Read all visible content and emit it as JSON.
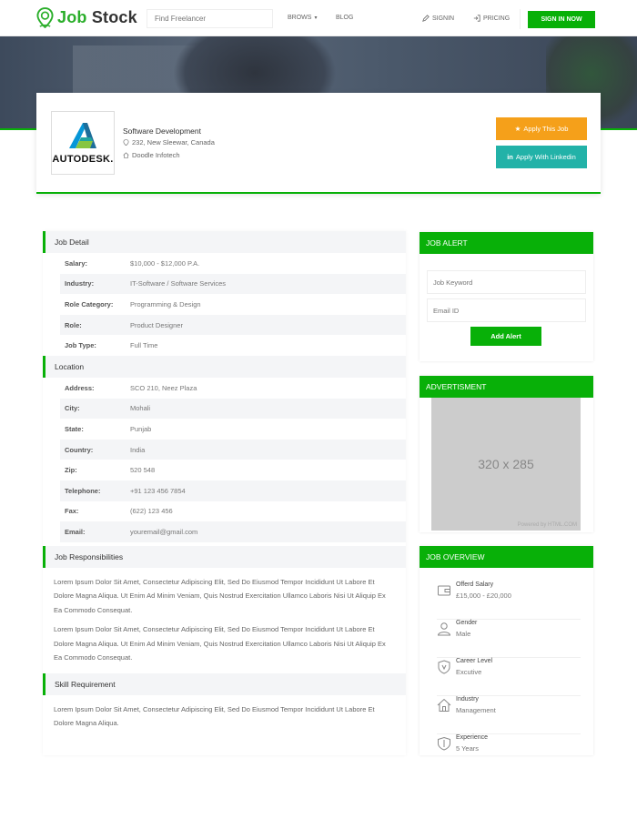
{
  "nav": {
    "logo_prefix": "Job",
    "logo_suffix": "Stock",
    "search_placeholder": "Find Freelancer",
    "brows_label": "BROWS",
    "blog_label": "BLOG",
    "signin_label": "SIGNIN",
    "pricing_label": "PRICING",
    "signup_label": "SIGN IN NOW"
  },
  "company": {
    "brand": "AUTODESK.",
    "title": "Software Development",
    "address": "232, New Sleewar, Canada",
    "employer": "Doodle Infotech",
    "apply_label": "Apply This Job",
    "linkedin_label": "Apply With Linkedin"
  },
  "job_detail": {
    "heading": "Job Detail",
    "rows": [
      {
        "k": "Salary:",
        "v": "$10,000 - $12,000 P.A."
      },
      {
        "k": "Industry:",
        "v": "IT-Software / Software Services"
      },
      {
        "k": "Role Category:",
        "v": "Programming & Design"
      },
      {
        "k": "Role:",
        "v": "Product Designer"
      },
      {
        "k": "Job Type:",
        "v": "Full Time"
      }
    ]
  },
  "location": {
    "heading": "Location",
    "rows": [
      {
        "k": "Address:",
        "v": "SCO 210, Neez Plaza"
      },
      {
        "k": "City:",
        "v": "Mohali"
      },
      {
        "k": "State:",
        "v": "Punjab"
      },
      {
        "k": "Country:",
        "v": "India"
      },
      {
        "k": "Zip:",
        "v": "520 548"
      },
      {
        "k": "Telephone:",
        "v": "+91 123 456 7854"
      },
      {
        "k": "Fax:",
        "v": "(622) 123 456"
      },
      {
        "k": "Email:",
        "v": "youremail@gmail.com"
      }
    ]
  },
  "responsibilities": {
    "heading": "Job Responsibilities",
    "p1": "Lorem Ipsum Dolor Sit Amet, Consectetur Adipiscing Elit, Sed Do Eiusmod Tempor Incididunt Ut Labore Et Dolore Magna Aliqua. Ut Enim Ad Minim Veniam, Quis Nostrud Exercitation Ullamco Laboris Nisi Ut Aliquip Ex Ea Commodo Consequat.",
    "p2": "Lorem Ipsum Dolor Sit Amet, Consectetur Adipiscing Elit, Sed Do Eiusmod Tempor Incididunt Ut Labore Et Dolore Magna Aliqua. Ut Enim Ad Minim Veniam, Quis Nostrud Exercitation Ullamco Laboris Nisi Ut Aliquip Ex Ea Commodo Consequat."
  },
  "skills": {
    "heading": "Skill Requirement",
    "p1": "Lorem Ipsum Dolor Sit Amet, Consectetur Adipiscing Elit, Sed Do Eiusmod Tempor Incididunt Ut Labore Et Dolore Magna Aliqua."
  },
  "job_alert": {
    "heading": "JOB ALERT",
    "keyword_placeholder": "Job Keyword",
    "email_placeholder": "Email ID",
    "button_label": "Add Alert"
  },
  "advert": {
    "heading": "ADVERTISMENT",
    "size_text": "320 x 285",
    "powered": "Powered by HTML.COM"
  },
  "overview": {
    "heading": "JOB OVERVIEW",
    "items": [
      {
        "label": "Offerd Salary",
        "value": "£15,000 - £20,000",
        "icon": "wallet-icon"
      },
      {
        "label": "Gender",
        "value": "Male",
        "icon": "user-icon"
      },
      {
        "label": "Career Level",
        "value": "Excutive",
        "icon": "shield-icon"
      },
      {
        "label": "Industry",
        "value": "Management",
        "icon": "home-icon"
      },
      {
        "label": "Experience",
        "value": "5 Years",
        "icon": "experience-icon"
      }
    ]
  },
  "colors": {
    "accent": "#08b008",
    "orange": "#f5a01a",
    "teal": "#22b2a8"
  }
}
